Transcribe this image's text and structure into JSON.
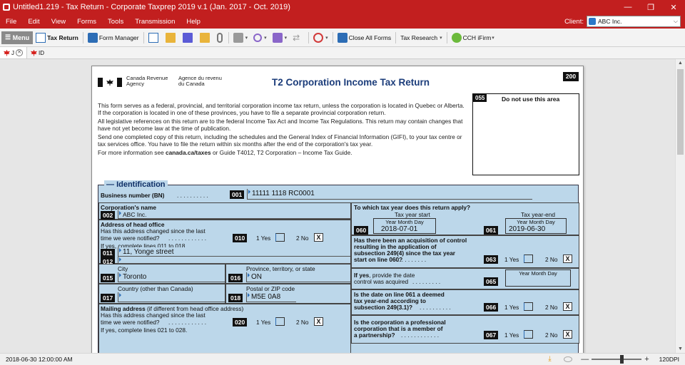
{
  "window": {
    "title": "Untitled1.219 - Tax Return - Corporate Taxprep 2019 v.1 (Jan. 2017 - Oct. 2019)"
  },
  "menu": [
    "File",
    "Edit",
    "View",
    "Forms",
    "Tools",
    "Transmission",
    "Help"
  ],
  "client": {
    "label": "Client:",
    "value": "ABC Inc."
  },
  "toolbar": {
    "menu": "Menu",
    "tax_return": "Tax Return",
    "form_manager": "Form Manager",
    "close_all": "Close All Forms",
    "tax_research": "Tax Research",
    "ifirm": "CCH iFirm"
  },
  "tabs": [
    {
      "label": "J"
    },
    {
      "label": "ID"
    }
  ],
  "form": {
    "agency_en": [
      "Canada Revenue",
      "Agency"
    ],
    "agency_fr": [
      "Agence du revenu",
      "du Canada"
    ],
    "title": "T2 Corporation Income Tax Return",
    "number": "200",
    "box055": {
      "code": "055",
      "text": "Do not use this area"
    },
    "intro": [
      "This form serves as a federal, provincial, and territorial corporation income tax return, unless the corporation is located in Quebec or Alberta. If the corporation is located in one of these provinces, you have to file a separate provincial corporation return.",
      "All legislative references on this return are to the federal Income Tax Act and Income Tax Regulations. This return may contain changes that have not yet become law at the time of publication.",
      "Send one completed copy of this return, including the schedules and the General Index of Financial Information (GIFI), to your tax centre or tax services office. You have to file the return within six months after the end of the corporation's tax year."
    ],
    "intro_more_prefix": "For more information see ",
    "intro_more_link": "canada.ca/taxes",
    "intro_more_suffix": " or Guide T4012, T2 Corporation – Income Tax Guide.",
    "identification": {
      "title": "Identification",
      "bn_label": "Business number (BN)",
      "bn_dots": ". . . . . . . . . .",
      "bn_code": "001",
      "bn_value": "11111 1118 RC0001",
      "name_label": "Corporation's name",
      "name_code": "002",
      "name_value": "ABC Inc.",
      "head_office_label": "Address of head office",
      "head_changed_q1": "Has this address changed since the last",
      "head_changed_q2": "time we were notified?",
      "head_changed_dots": ". . . . . . . . . . . .",
      "code_010": "010",
      "yes_label": "1 Yes",
      "no_label": "2 No",
      "head_changed_value": "X",
      "if_yes_lines": "If yes, complete lines 011 to 018.",
      "code_011": "011",
      "addr1": "11, Yonge street",
      "code_012": "012",
      "city_label": "City",
      "code_015": "015",
      "city": "Toronto",
      "prov_label": "Province, territory, or state",
      "code_016": "016",
      "prov": "ON",
      "country_label": "Country (other than Canada)",
      "code_017": "017",
      "postal_label": "Postal or ZIP code",
      "code_018": "018",
      "postal": "M5E 0A8",
      "mailing_label": "Mailing address",
      "mailing_suffix": " (if different from head office address)",
      "mail_changed_q1": "Has this address changed since the last",
      "mail_changed_q2": "time we were notified?",
      "mail_changed_dots": ". . . . . . . . . . . .",
      "code_020": "020",
      "mail_changed_value": "X",
      "if_yes_mail": "If yes, complete lines 021 to 028.",
      "taxyear_q": "To which tax year does this return apply?",
      "taxyear_start_label": "Tax year start",
      "taxyear_end_label": "Tax year-end",
      "ymd": "Year Month Day",
      "code_060": "060",
      "start": "2018-07-01",
      "code_061": "061",
      "end": "2019-06-30",
      "acq_q": [
        "Has there been an acquisition of control",
        "resulting in the application of",
        "subsection 249(4) since the tax year",
        "start on line 060?"
      ],
      "acq_dots": ". . . . . . . . .",
      "code_063": "063",
      "acq_value": "X",
      "acq_date_q": [
        "If yes, provide the date",
        "control was acquired"
      ],
      "acq_date_dots": ". . . . . . . . .",
      "code_065": "065",
      "deemed_q": [
        "Is the date on line 061 a deemed",
        "tax year-end according to",
        "subsection 249(3.1)?"
      ],
      "deemed_dots": ". . . . . . . . . .",
      "code_066": "066",
      "deemed_value": "X",
      "prof_q": [
        "Is the corporation a professional",
        "corporation that is a member of",
        "a partnership?"
      ],
      "prof_dots": ". . . . . . . . . . . .",
      "code_067": "067",
      "prof_value": "X"
    }
  },
  "status": {
    "datetime": "2018-06-30 12:00:00 AM",
    "dpi": "120DPI"
  }
}
